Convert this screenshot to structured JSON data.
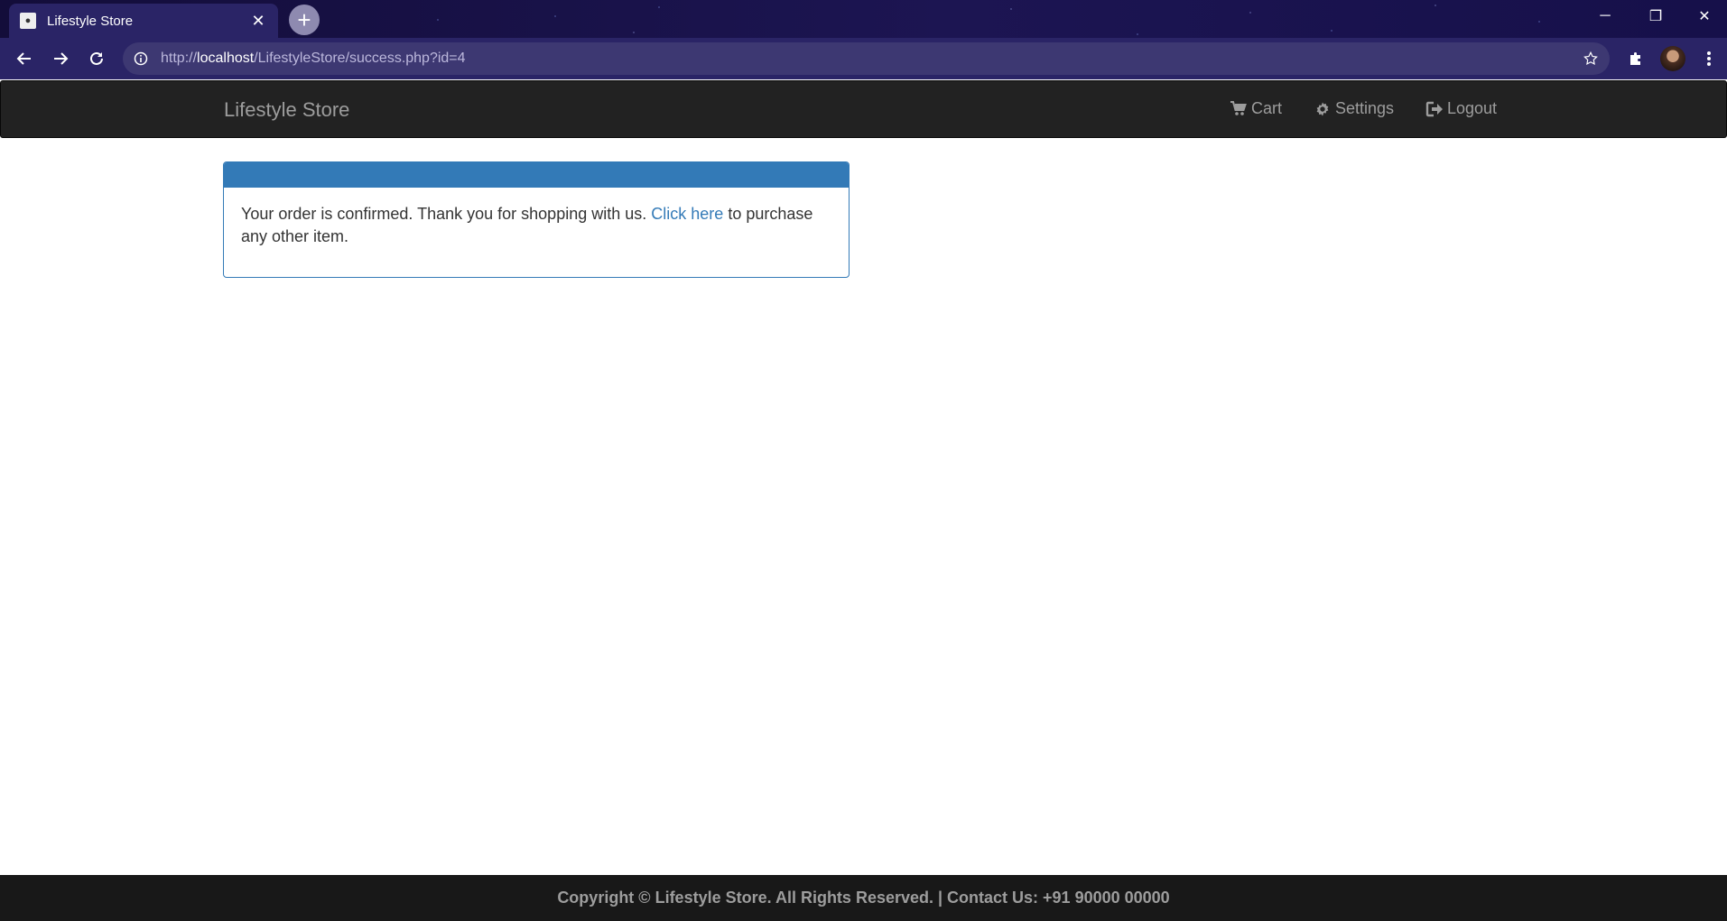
{
  "browser": {
    "tab_title": "Lifestyle Store",
    "new_tab_label": "+",
    "url_scheme": "http://",
    "url_host": "localhost",
    "url_path": "/LifestyleStore/success.php?id=4"
  },
  "navbar": {
    "brand": "Lifestyle Store",
    "links": [
      {
        "label": "Cart",
        "icon": "cart-icon"
      },
      {
        "label": "Settings",
        "icon": "gear-icon"
      },
      {
        "label": "Logout",
        "icon": "logout-icon"
      }
    ]
  },
  "panel": {
    "message_before": "Your order is confirmed. Thank you for shopping with us.",
    "link_text": "Click here",
    "message_after": "to purchase any other item."
  },
  "footer": {
    "text": "Copyright © Lifestyle Store. All Rights Reserved. | Contact Us: +91 90000 00000"
  },
  "colors": {
    "primary": "#337ab7",
    "navbar_bg": "#222222",
    "footer_bg": "#181818"
  }
}
